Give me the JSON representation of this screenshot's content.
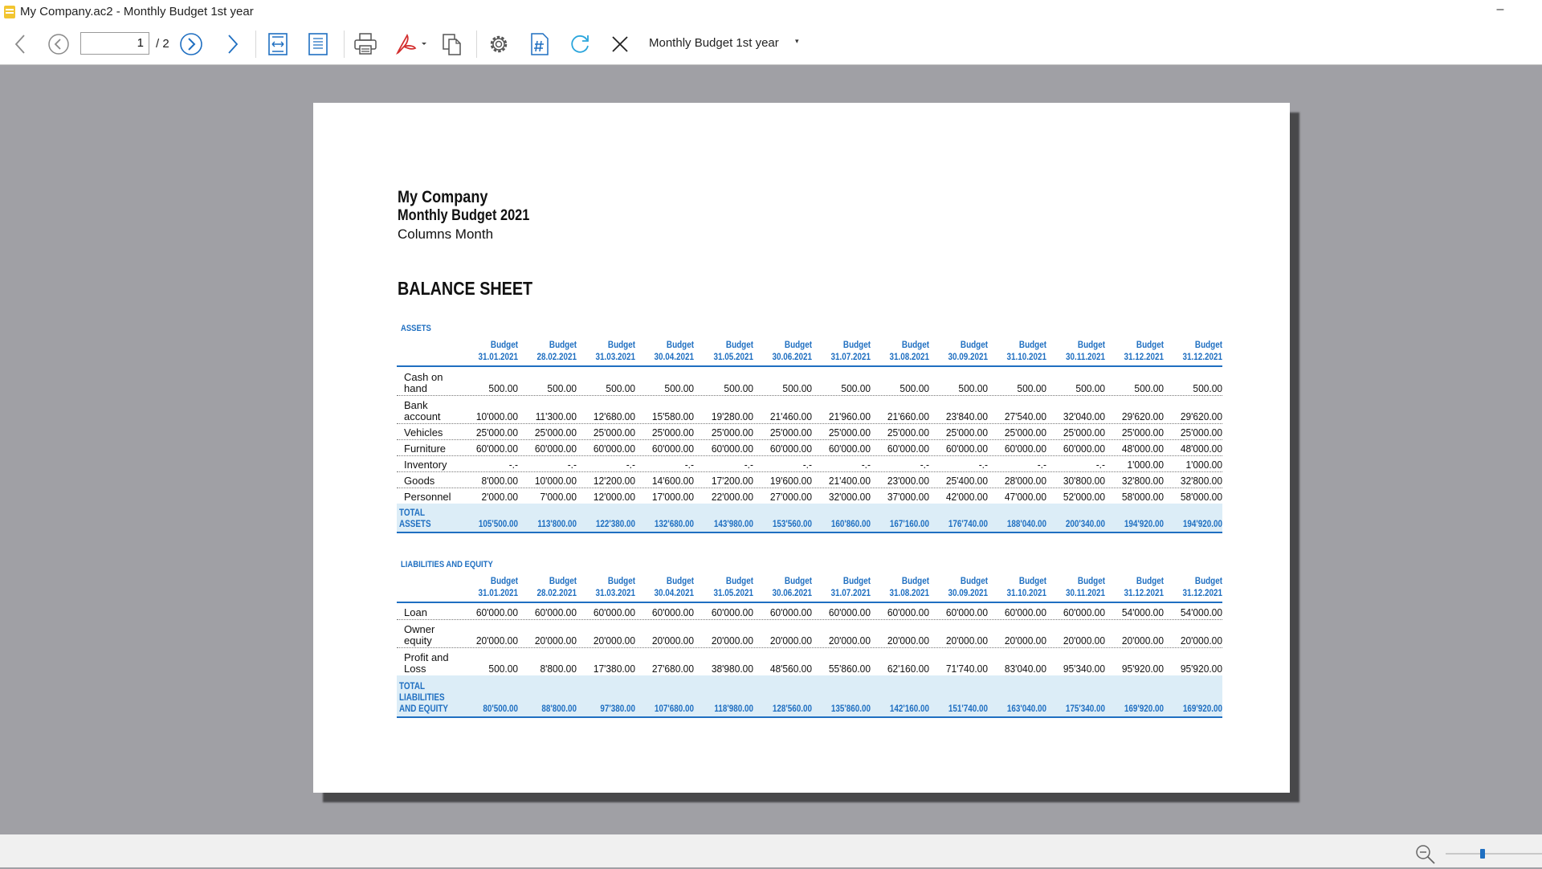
{
  "window": {
    "title": "My Company.ac2 - Monthly Budget 1st year",
    "minimize": "–"
  },
  "toolbar": {
    "page_current": "1",
    "page_total": "/ 2",
    "report_name": "Monthly Budget 1st year",
    "report_caret": "▾",
    "icons": [
      "back-icon",
      "first-page-icon",
      "next-page-icon",
      "forward-icon",
      "fit-width-icon",
      "fit-page-icon",
      "print-icon",
      "pdf-icon",
      "copy-icon",
      "settings-icon",
      "hash-icon",
      "refresh-icon",
      "close-icon"
    ]
  },
  "report": {
    "company": "My Company",
    "budget_title": "Monthly Budget 2021",
    "columns_label": "Columns Month",
    "balance_heading": "BALANCE SHEET",
    "column_headers": [
      {
        "label": "Budget",
        "date": "31.01.2021"
      },
      {
        "label": "Budget",
        "date": "28.02.2021"
      },
      {
        "label": "Budget",
        "date": "31.03.2021"
      },
      {
        "label": "Budget",
        "date": "30.04.2021"
      },
      {
        "label": "Budget",
        "date": "31.05.2021"
      },
      {
        "label": "Budget",
        "date": "30.06.2021"
      },
      {
        "label": "Budget",
        "date": "31.07.2021"
      },
      {
        "label": "Budget",
        "date": "31.08.2021"
      },
      {
        "label": "Budget",
        "date": "30.09.2021"
      },
      {
        "label": "Budget",
        "date": "31.10.2021"
      },
      {
        "label": "Budget",
        "date": "30.11.2021"
      },
      {
        "label": "Budget",
        "date": "31.12.2021"
      },
      {
        "label": "Budget",
        "date": "31.12.2021"
      }
    ],
    "assets": {
      "title": "ASSETS",
      "rows": [
        {
          "label": "Cash on hand",
          "values": [
            "500.00",
            "500.00",
            "500.00",
            "500.00",
            "500.00",
            "500.00",
            "500.00",
            "500.00",
            "500.00",
            "500.00",
            "500.00",
            "500.00",
            "500.00"
          ]
        },
        {
          "label": "Bank account",
          "values": [
            "10'000.00",
            "11'300.00",
            "12'680.00",
            "15'580.00",
            "19'280.00",
            "21'460.00",
            "21'960.00",
            "21'660.00",
            "23'840.00",
            "27'540.00",
            "32'040.00",
            "29'620.00",
            "29'620.00"
          ]
        },
        {
          "label": "Vehicles",
          "values": [
            "25'000.00",
            "25'000.00",
            "25'000.00",
            "25'000.00",
            "25'000.00",
            "25'000.00",
            "25'000.00",
            "25'000.00",
            "25'000.00",
            "25'000.00",
            "25'000.00",
            "25'000.00",
            "25'000.00"
          ]
        },
        {
          "label": "Furniture",
          "values": [
            "60'000.00",
            "60'000.00",
            "60'000.00",
            "60'000.00",
            "60'000.00",
            "60'000.00",
            "60'000.00",
            "60'000.00",
            "60'000.00",
            "60'000.00",
            "60'000.00",
            "48'000.00",
            "48'000.00"
          ]
        },
        {
          "label": "Inventory",
          "values": [
            "-.-",
            "-.-",
            "-.-",
            "-.-",
            "-.-",
            "-.-",
            "-.-",
            "-.-",
            "-.-",
            "-.-",
            "-.-",
            "1'000.00",
            "1'000.00"
          ]
        },
        {
          "label": "Goods",
          "values": [
            "8'000.00",
            "10'000.00",
            "12'200.00",
            "14'600.00",
            "17'200.00",
            "19'600.00",
            "21'400.00",
            "23'000.00",
            "25'400.00",
            "28'000.00",
            "30'800.00",
            "32'800.00",
            "32'800.00"
          ]
        },
        {
          "label": "Personnel",
          "values": [
            "2'000.00",
            "7'000.00",
            "12'000.00",
            "17'000.00",
            "22'000.00",
            "27'000.00",
            "32'000.00",
            "37'000.00",
            "42'000.00",
            "47'000.00",
            "52'000.00",
            "58'000.00",
            "58'000.00"
          ]
        }
      ],
      "total": {
        "label": "TOTAL ASSETS",
        "values": [
          "105'500.00",
          "113'800.00",
          "122'380.00",
          "132'680.00",
          "143'980.00",
          "153'560.00",
          "160'860.00",
          "167'160.00",
          "176'740.00",
          "188'040.00",
          "200'340.00",
          "194'920.00",
          "194'920.00"
        ]
      }
    },
    "liabilities": {
      "title": "LIABILITIES AND EQUITY",
      "rows": [
        {
          "label": "Loan",
          "values": [
            "60'000.00",
            "60'000.00",
            "60'000.00",
            "60'000.00",
            "60'000.00",
            "60'000.00",
            "60'000.00",
            "60'000.00",
            "60'000.00",
            "60'000.00",
            "60'000.00",
            "54'000.00",
            "54'000.00"
          ]
        },
        {
          "label": "Owner equity",
          "values": [
            "20'000.00",
            "20'000.00",
            "20'000.00",
            "20'000.00",
            "20'000.00",
            "20'000.00",
            "20'000.00",
            "20'000.00",
            "20'000.00",
            "20'000.00",
            "20'000.00",
            "20'000.00",
            "20'000.00"
          ]
        },
        {
          "label": "Profit and Loss",
          "values": [
            "500.00",
            "8'800.00",
            "17'380.00",
            "27'680.00",
            "38'980.00",
            "48'560.00",
            "55'860.00",
            "62'160.00",
            "71'740.00",
            "83'040.00",
            "95'340.00",
            "95'920.00",
            "95'920.00"
          ]
        }
      ],
      "total": {
        "label": "TOTAL LIABILITIES AND EQUITY",
        "values": [
          "80'500.00",
          "88'800.00",
          "97'380.00",
          "107'680.00",
          "118'980.00",
          "128'560.00",
          "135'860.00",
          "142'160.00",
          "151'740.00",
          "163'040.00",
          "175'340.00",
          "169'920.00",
          "169'920.00"
        ]
      }
    }
  },
  "status": {
    "zoom_level": 0.38
  },
  "colors": {
    "accent": "#1f6fc1",
    "total_bg": "#dcedf7",
    "canvas": "#a0a0a5",
    "pdf_red": "#d32f2f"
  }
}
